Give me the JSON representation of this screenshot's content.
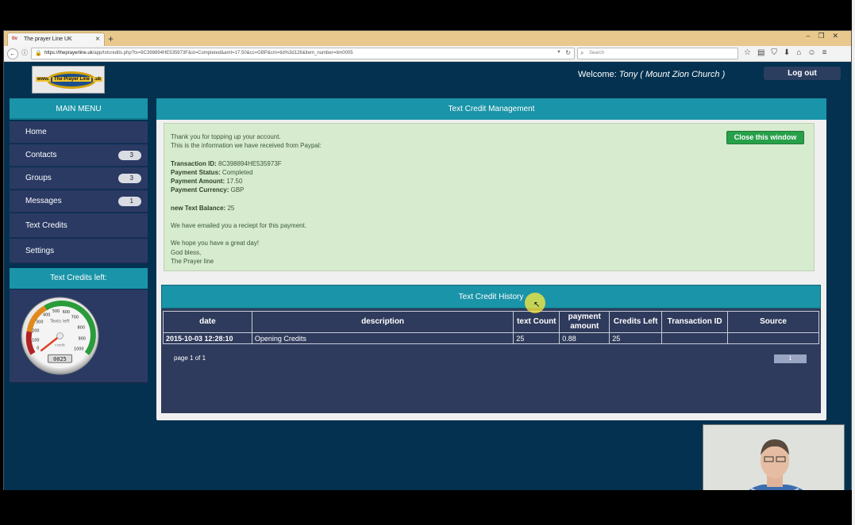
{
  "browser": {
    "tab_title": "The prayer Line UK",
    "tab_favicon": "tlv",
    "url_domain": "https://theprayerline.uk",
    "url_path": "/app/txtcredits.php?tx=8C398894HE535973F&st=Completed&amt=17.50&cc=GBP&cm=tid%3d126&item_number=itm0005",
    "search_placeholder": "Search"
  },
  "header": {
    "logo_text": "www.",
    "logo_brand": "The Prayer Line",
    "logo_suffix": ".uk",
    "welcome_label": "Welcome:",
    "welcome_user": "Tony ( Mount Zion Church )",
    "logout_label": "Log out"
  },
  "sidebar": {
    "title": "MAIN MENU",
    "items": [
      {
        "label": "Home",
        "badge": ""
      },
      {
        "label": "Contacts",
        "badge": "3"
      },
      {
        "label": "Groups",
        "badge": "3"
      },
      {
        "label": "Messages",
        "badge": "1"
      },
      {
        "label": "Text Credits",
        "badge": ""
      },
      {
        "label": "Settings",
        "badge": ""
      }
    ],
    "credits_title": "Text Credits left:",
    "gauge": {
      "label": "Texts left",
      "sublabel": "credit",
      "readout": "0025",
      "value": 25,
      "max": 1000,
      "ticks": [
        "0",
        "100",
        "200",
        "300",
        "400",
        "500",
        "600",
        "700",
        "800",
        "900",
        "1000"
      ]
    }
  },
  "main": {
    "title": "Text Credit Management",
    "close_button": "Close this window",
    "notice": {
      "line1": "Thank you for topping up your account.",
      "line2": "This is the information we have received from Paypal:",
      "txn_label": "Transaction ID:",
      "txn_value": "8C398894HE535973F",
      "status_label": "Payment Status:",
      "status_value": "Completed",
      "amount_label": "Payment Amount:",
      "amount_value": "17.50",
      "currency_label": "Payment Currency:",
      "currency_value": "GBP",
      "balance_label": "new Text Balance:",
      "balance_value": "25",
      "emailed": "We have emailed you a reciept for this payment.",
      "wish": "We hope you have a great day!",
      "bless": "God bless,",
      "sign": "The Prayer line"
    },
    "history": {
      "title": "Text Credit History",
      "columns": [
        "date",
        "description",
        "text Count",
        "payment amount",
        "Credits Left",
        "Transaction ID",
        "Source"
      ],
      "rows": [
        [
          "2015-10-03 12:28:10",
          "Opening Credits",
          "25",
          "0.88",
          "25",
          "",
          ""
        ]
      ],
      "page_info": "page 1 of 1",
      "page_button": "1"
    }
  }
}
